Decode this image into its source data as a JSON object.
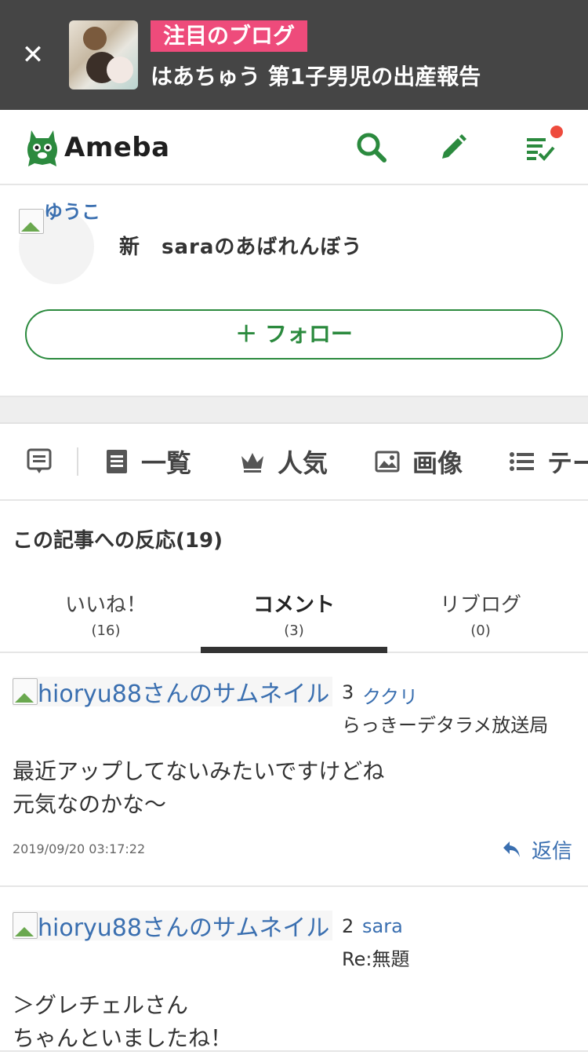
{
  "promo": {
    "badge": "注目のブログ",
    "headline": "はあちゅう 第1子男児の出産報告",
    "close_icon": "close-icon"
  },
  "header": {
    "logo_text": "Ameba",
    "icons": [
      "search-icon",
      "edit-icon",
      "feed-icon"
    ],
    "brand_color": "#2b8a3e"
  },
  "profile": {
    "avatar_alt": "ゆうこ",
    "blog_title": "新　saraのあばれんぼう",
    "follow_label": "＋ フォロー"
  },
  "navmenu": {
    "items": [
      {
        "label": "一覧",
        "icon": "article-list-icon"
      },
      {
        "label": "人気",
        "icon": "crown-icon"
      },
      {
        "label": "画像",
        "icon": "image-icon"
      },
      {
        "label": "テー",
        "icon": "theme-list-icon"
      }
    ]
  },
  "reactions": {
    "title": "この記事への反応(19)",
    "tabs": [
      {
        "label": "いいね！",
        "count": "(16)"
      },
      {
        "label": "コメント",
        "count": "(3)"
      },
      {
        "label": "リブログ",
        "count": "(0)"
      }
    ],
    "active_tab": 1
  },
  "comments": [
    {
      "thumb_alt": "hioryu88さんのサムネイル",
      "number": "3",
      "name": "ククリ",
      "subtitle": "らっきーデタラメ放送局",
      "body": "最近アップしてないみたいですけどね\n元気なのかな～",
      "date": "2019/09/20 03:17:22",
      "reply_label": "返信"
    },
    {
      "thumb_alt": "hioryu88さんのサムネイル",
      "number": "2",
      "name": "sara",
      "subtitle": "Re:無題",
      "body": "＞グレチェルさん\nちゃんといましたね！"
    }
  ]
}
